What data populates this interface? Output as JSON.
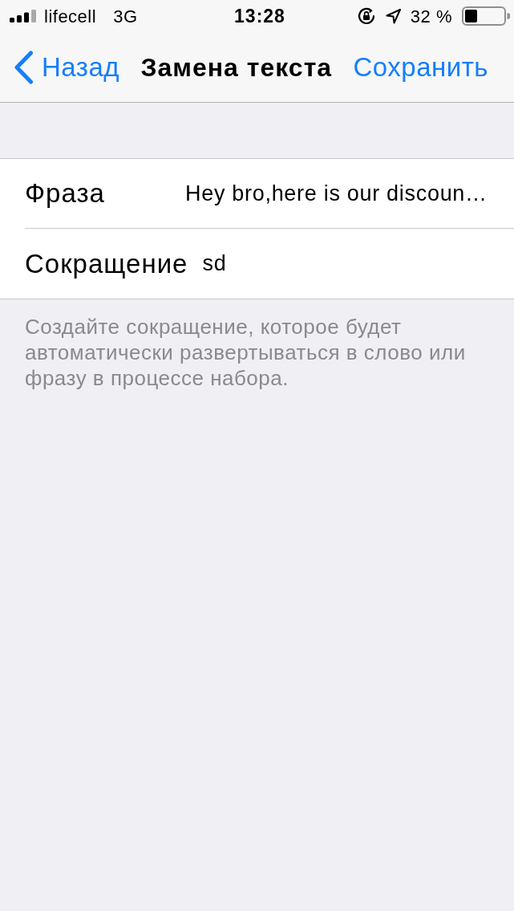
{
  "status_bar": {
    "carrier": "lifecell",
    "network": "3G",
    "time": "13:28",
    "battery": "32 %"
  },
  "nav_bar": {
    "back": "Назад",
    "title": "Замена текста",
    "action": "Сохранить"
  },
  "fields": [
    {
      "label": "Фраза",
      "value": "Hey bro,here is our discoun…"
    },
    {
      "label": "Сокращение",
      "value": "sd"
    }
  ],
  "footer": "Создайте сокращение, которое будет автоматически развертываться в слово или фразу в процессе набора."
}
